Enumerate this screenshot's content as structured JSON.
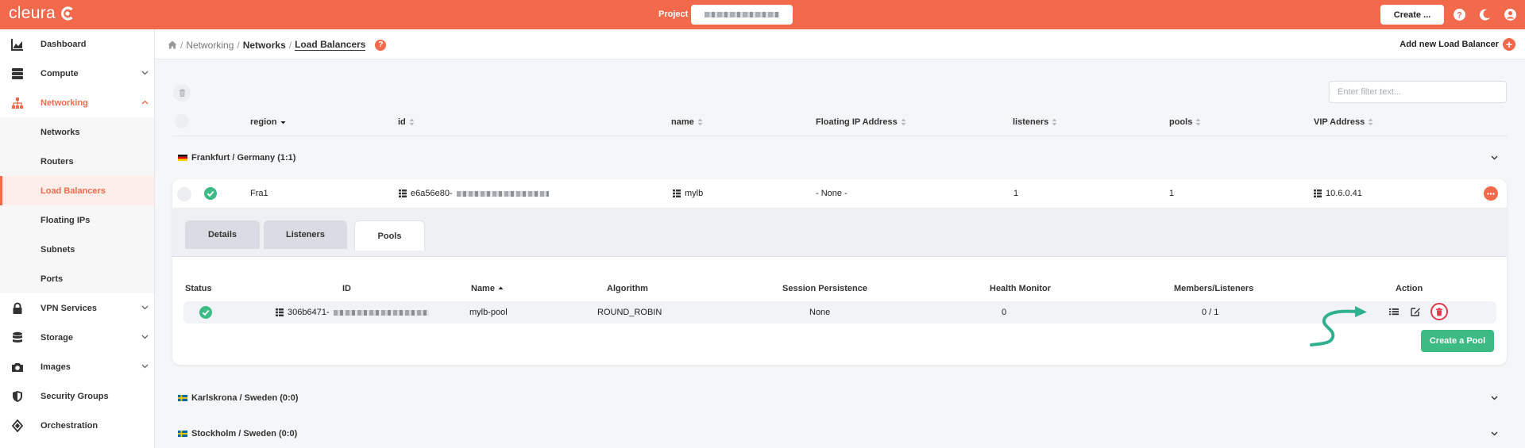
{
  "app": {
    "logo_text": "cleura"
  },
  "topbar": {
    "project_label": "Project",
    "create_label": "Create ..."
  },
  "sidebar": {
    "items": [
      {
        "label": "Dashboard"
      },
      {
        "label": "Compute"
      },
      {
        "label": "Networking"
      },
      {
        "label": "Networks"
      },
      {
        "label": "Routers"
      },
      {
        "label": "Load Balancers"
      },
      {
        "label": "Floating IPs"
      },
      {
        "label": "Subnets"
      },
      {
        "label": "Ports"
      },
      {
        "label": "VPN Services"
      },
      {
        "label": "Storage"
      },
      {
        "label": "Images"
      },
      {
        "label": "Security Groups"
      },
      {
        "label": "Orchestration"
      }
    ]
  },
  "breadcrumb": {
    "sep": "/",
    "level1": "Networking",
    "level2": "Networks",
    "current": "Load Balancers",
    "help": "?"
  },
  "header": {
    "add_label": "Add new Load Balancer",
    "add_symbol": "+"
  },
  "filter": {
    "placeholder": "Enter filter text..."
  },
  "table": {
    "headers": [
      "region",
      "id",
      "name",
      "Floating IP Address",
      "listeners",
      "pools",
      "VIP Address"
    ]
  },
  "groups": [
    {
      "label": "Frankfurt / Germany (1:1)"
    },
    {
      "label": "Karlskrona / Sweden (0:0)"
    },
    {
      "label": "Stockholm / Sweden (0:0)"
    }
  ],
  "load_balancer": {
    "region": "Fra1",
    "id_prefix": "e6a56e80-",
    "name": "mylb",
    "floating_ip": "- None -",
    "listeners": "1",
    "pools": "1",
    "vip": "10.6.0.41"
  },
  "tabs": [
    "Details",
    "Listeners",
    "Pools"
  ],
  "pools_table": {
    "headers": [
      "Status",
      "ID",
      "Name",
      "Algorithm",
      "Session Persistence",
      "Health Monitor",
      "Members/Listeners",
      "Action"
    ],
    "row": {
      "id_prefix": "306b6471-",
      "name": "mylb-pool",
      "algorithm": "ROUND_ROBIN",
      "session_persistence": "None",
      "health_monitor": "0",
      "members_listeners": "0 / 1"
    },
    "create_label": "Create a Pool"
  },
  "colors": {
    "brand": "#f26a4b",
    "success": "#3dbb84",
    "danger": "#e0394b",
    "annotation": "#2fb08e"
  }
}
